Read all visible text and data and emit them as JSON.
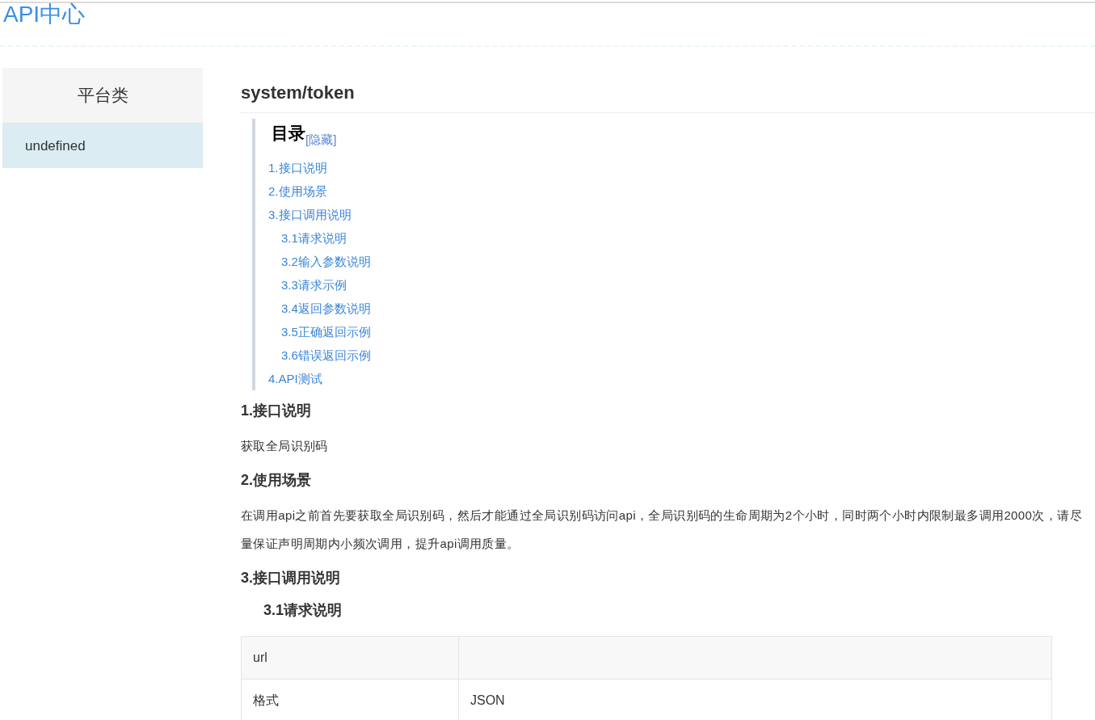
{
  "site_title": "API中心",
  "sidebar": {
    "heading": "平台类",
    "items": [
      {
        "label": "undefined",
        "selected": true
      }
    ]
  },
  "page_title": "system/token",
  "toc": {
    "title": "目录",
    "toggle": "[隐藏]",
    "items": [
      {
        "label": "1.接口说明"
      },
      {
        "label": "2.使用场景"
      },
      {
        "label": "3.接口调用说明",
        "children": [
          {
            "label": "3.1请求说明"
          },
          {
            "label": "3.2输入参数说明"
          },
          {
            "label": "3.3请求示例"
          },
          {
            "label": "3.4返回参数说明"
          },
          {
            "label": "3.5正确返回示例"
          },
          {
            "label": "3.6错误返回示例"
          }
        ]
      },
      {
        "label": "4.API测试"
      }
    ]
  },
  "sections": [
    {
      "kind": "heading",
      "text": "1.接口说明"
    },
    {
      "kind": "paragraph",
      "text": "获取全局识别码"
    },
    {
      "kind": "heading",
      "text": "2.使用场景"
    },
    {
      "kind": "paragraph",
      "text": "在调用api之前首先要获取全局识别码，然后才能通过全局识别码访问api，全局识别码的生命周期为2个小时，同时两个小时内限制最多调用2000次，请尽量保证声明周期内小频次调用，提升api调用质量。"
    },
    {
      "kind": "heading",
      "text": "3.接口调用说明"
    },
    {
      "kind": "subheading",
      "text": "3.1请求说明"
    }
  ],
  "table": {
    "rows": [
      {
        "cells": [
          "url",
          ""
        ]
      },
      {
        "cells": [
          "格式",
          "JSON"
        ]
      }
    ]
  }
}
